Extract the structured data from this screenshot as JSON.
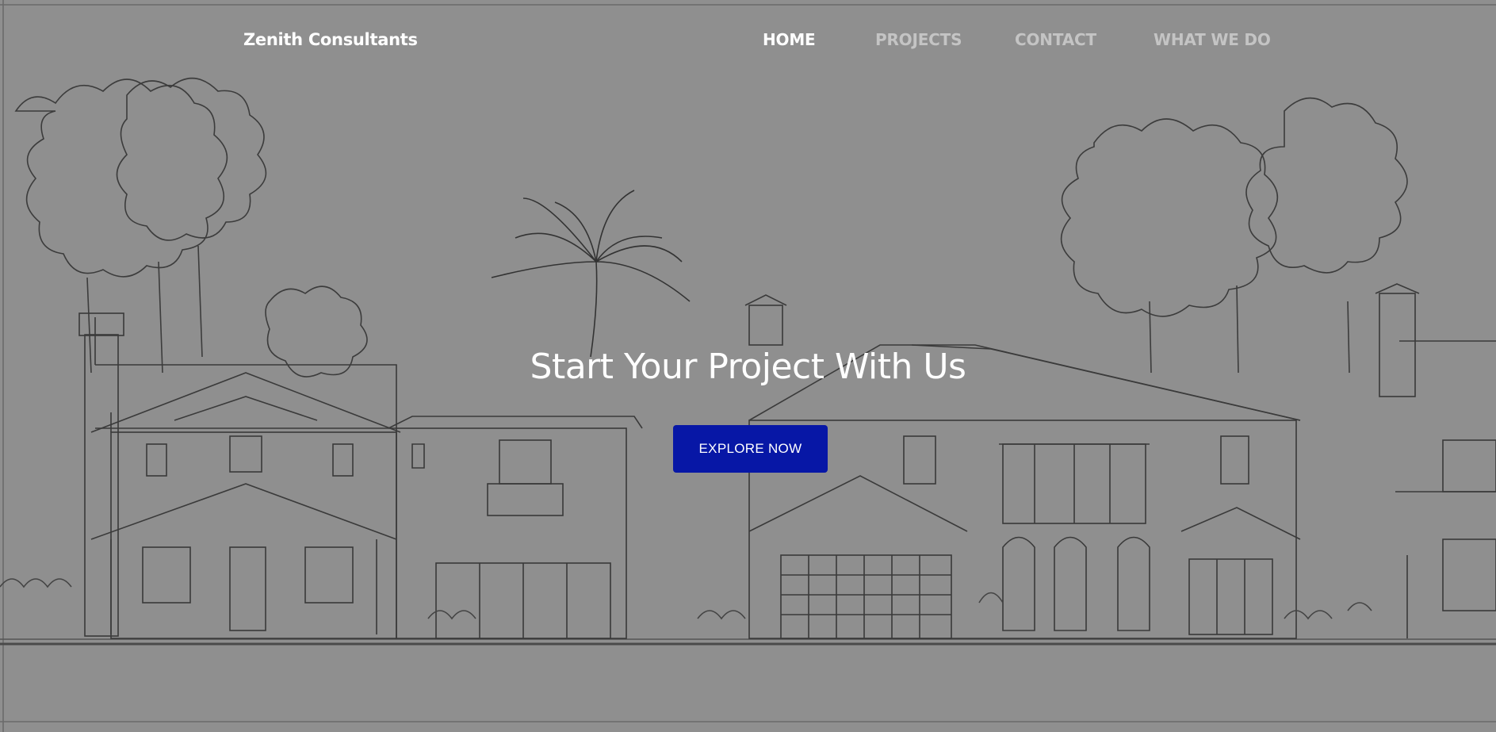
{
  "brand": {
    "name": "Zenith Consultants"
  },
  "nav": {
    "items": [
      {
        "label": "HOME",
        "active": true
      },
      {
        "label": "PROJECTS",
        "active": false
      },
      {
        "label": "CONTACT",
        "active": false
      },
      {
        "label": "WHAT WE DO",
        "active": false
      }
    ]
  },
  "hero": {
    "headline": "Start Your Project With Us",
    "cta_label": "EXPLORE NOW",
    "background_description_icon": "house-sketch-illustration"
  },
  "colors": {
    "page_background": "#8f8f8f",
    "cta_background": "#0717a6",
    "nav_active": "#ffffff",
    "nav_inactive": "#c4c4c4",
    "sketch_line": "#3a3a3a"
  }
}
